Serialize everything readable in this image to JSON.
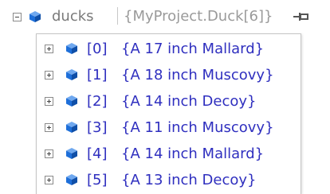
{
  "header": {
    "name": "ducks",
    "value": "{MyProject.Duck[6]}"
  },
  "items": [
    {
      "index": "[0]",
      "value": "{A 17 inch Mallard}"
    },
    {
      "index": "[1]",
      "value": "{A 18 inch Muscovy}"
    },
    {
      "index": "[2]",
      "value": "{A 14 inch Decoy}"
    },
    {
      "index": "[3]",
      "value": "{A 11 inch Muscovy}"
    },
    {
      "index": "[4]",
      "value": "{A 14 inch Mallard}"
    },
    {
      "index": "[5]",
      "value": "{A 13 inch Decoy}"
    }
  ],
  "colors": {
    "object_icon": "#1e6fd9",
    "member_text": "#2f2fbf",
    "header_text": "#7a7a7a"
  },
  "icons": {
    "expander_header": "collapse-icon",
    "expander_item": "expand-icon",
    "object": "object-icon",
    "pin": "pin-icon"
  }
}
